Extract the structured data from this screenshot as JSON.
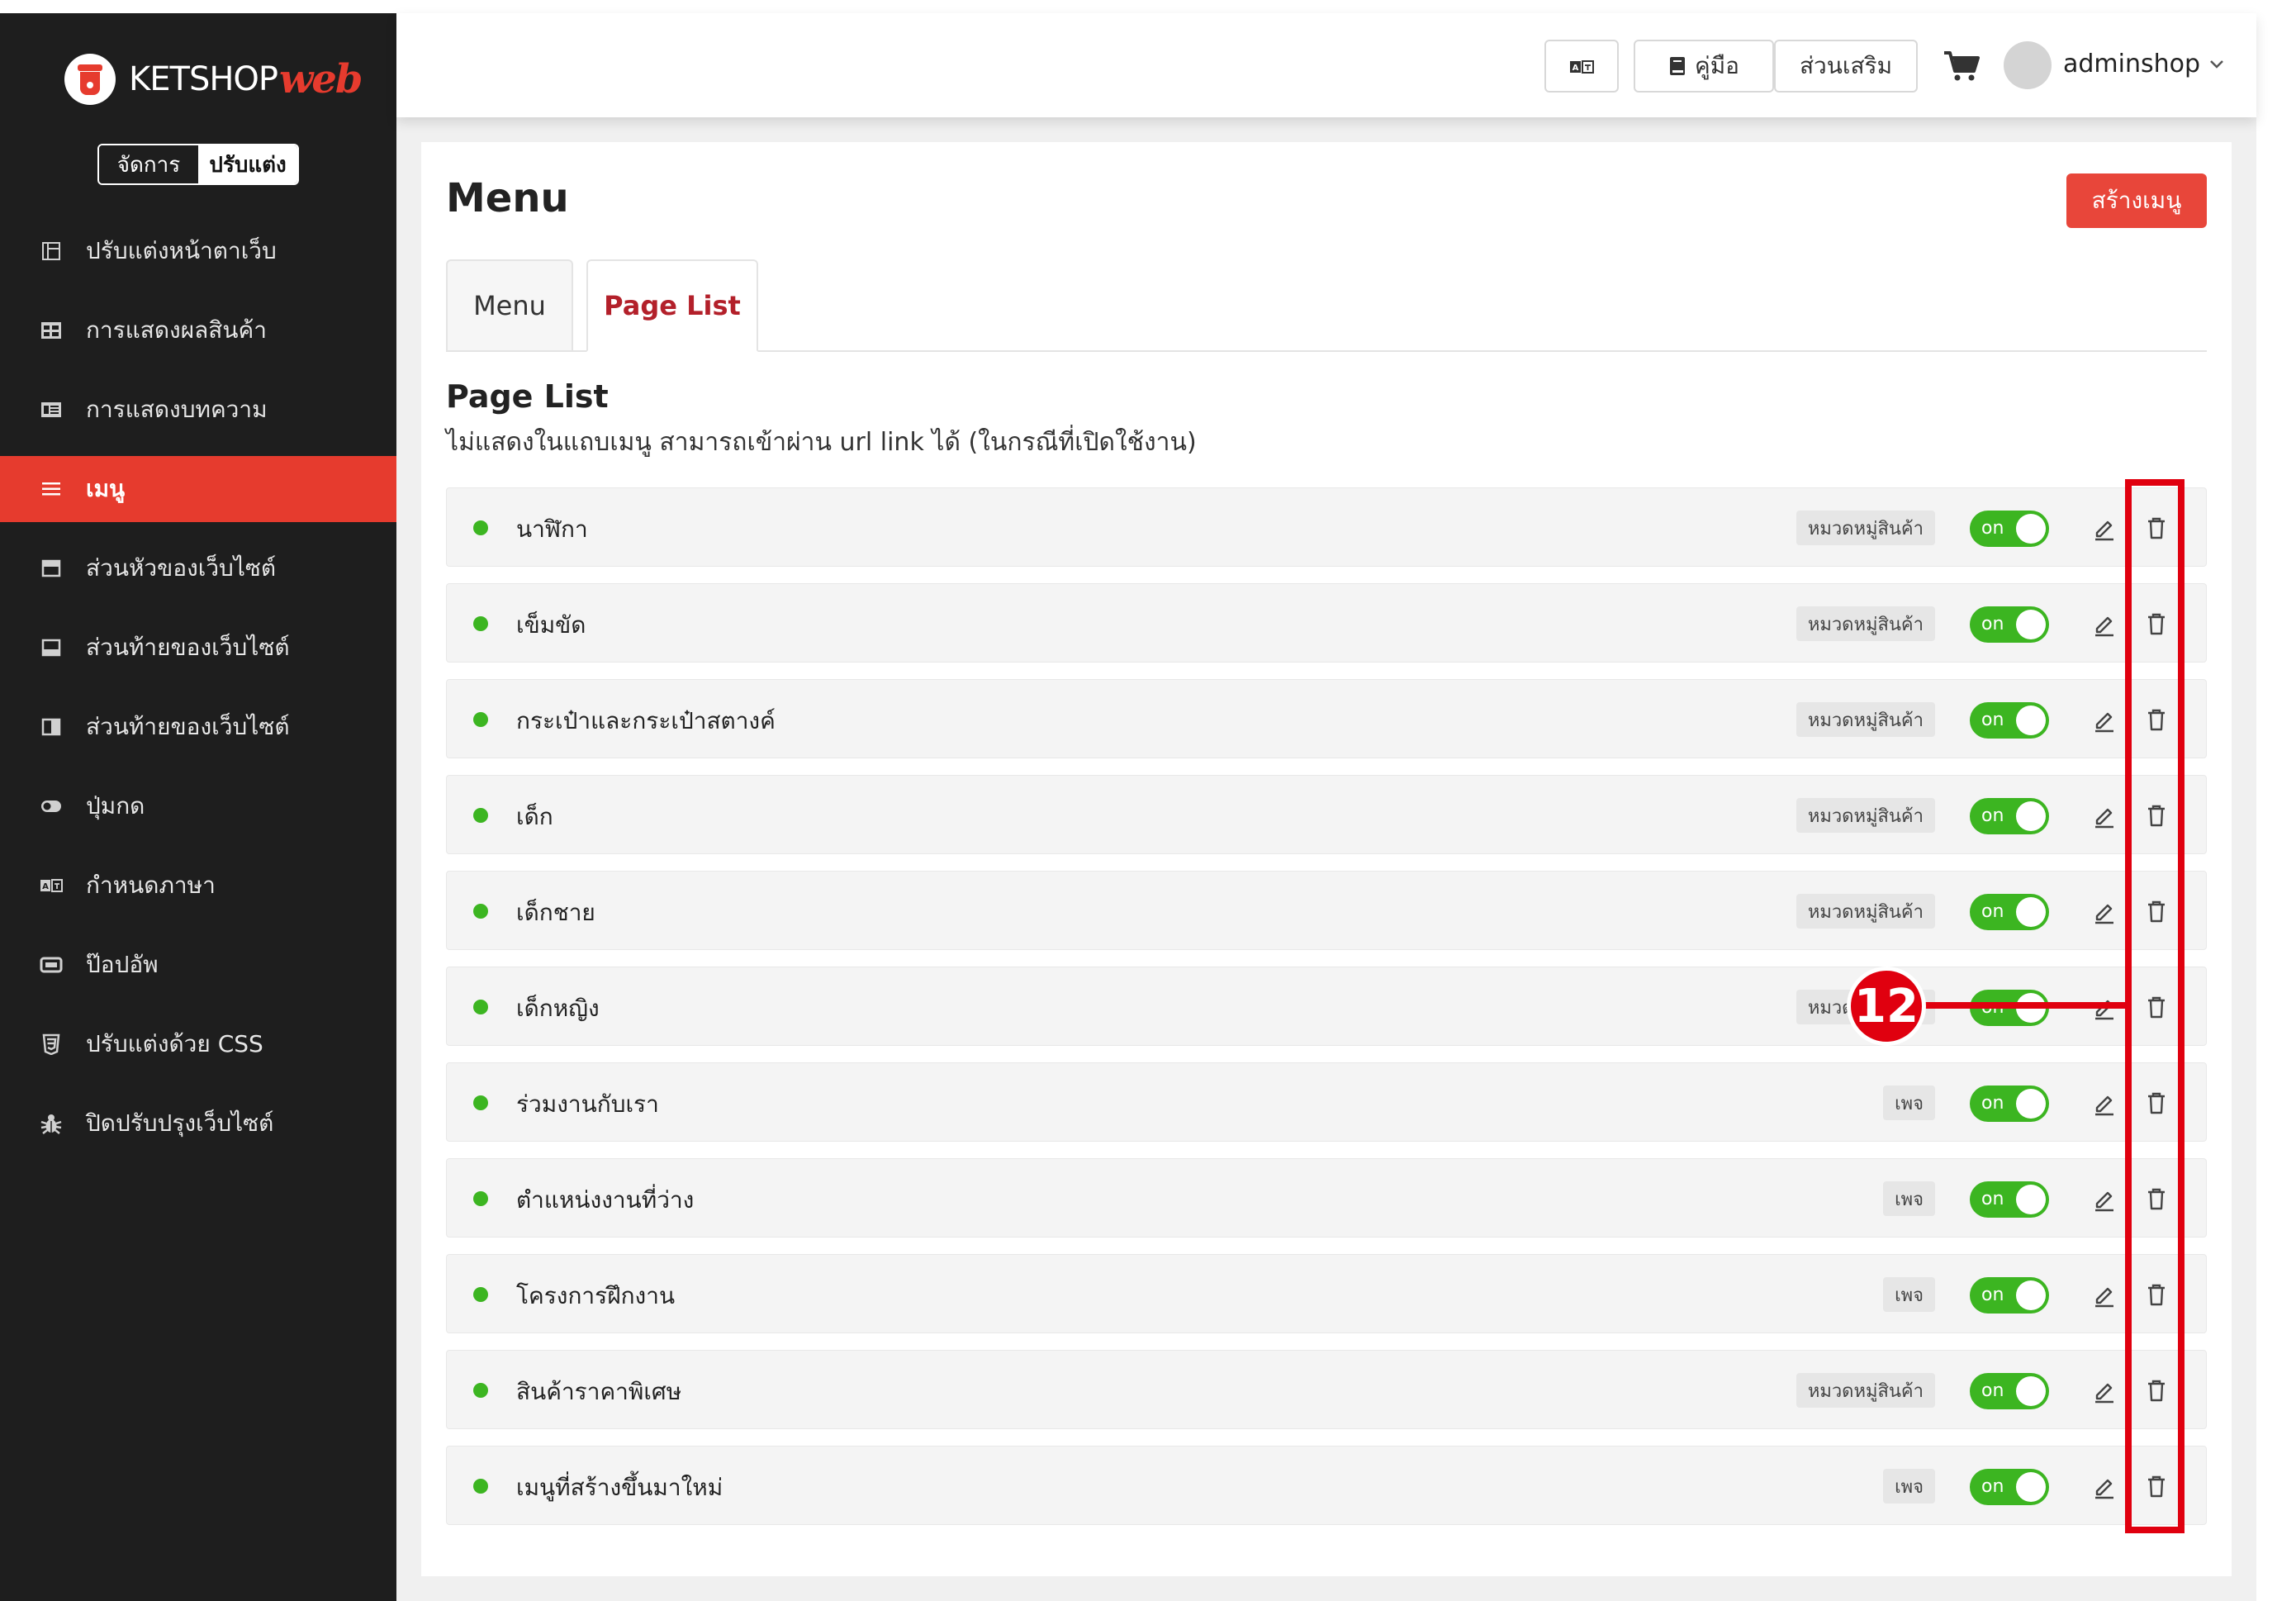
{
  "brand": {
    "name_a": "KETSHOP",
    "name_b": "web"
  },
  "mode_toggle": {
    "manage": "จัดการ",
    "customize": "ปรับแต่ง"
  },
  "sidebar": {
    "items": [
      {
        "label": "ปรับแต่งหน้าตาเว็บ",
        "icon": "layout-icon"
      },
      {
        "label": "การแสดงผลสินค้า",
        "icon": "grid-icon"
      },
      {
        "label": "การแสดงบทความ",
        "icon": "article-icon"
      },
      {
        "label": "เมนู",
        "icon": "menu-icon"
      },
      {
        "label": "ส่วนหัวของเว็บไซต์",
        "icon": "header-icon"
      },
      {
        "label": "ส่วนท้ายของเว็บไซต์",
        "icon": "footer-icon"
      },
      {
        "label": "ส่วนท้ายของเว็บไซต์",
        "icon": "sidebar-panel-icon"
      },
      {
        "label": "ปุ่มกด",
        "icon": "toggle-icon"
      },
      {
        "label": "กำหนดภาษา",
        "icon": "language-icon"
      },
      {
        "label": "ป๊อปอัพ",
        "icon": "popup-icon"
      },
      {
        "label": "ปรับแต่งด้วย CSS",
        "icon": "css3-icon"
      },
      {
        "label": "ปิดปรับปรุงเว็บไซต์",
        "icon": "bug-icon"
      }
    ],
    "active_index": 3
  },
  "topbar": {
    "manual_label": "คู่มือ",
    "addons_label": "ส่วนเสริม",
    "username": "adminshop"
  },
  "main": {
    "title": "Menu",
    "create_button": "สร้างเมนู",
    "tabs": [
      {
        "label": "Menu",
        "active": false
      },
      {
        "label": "Page List",
        "active": true
      }
    ],
    "section_title": "Page List",
    "section_desc": "ไม่แสดงในแถบเมนู สามารถเข้าผ่าน url link ได้ (ในกรณีที่เปิดใช้งาน)",
    "toggle_text": "on",
    "rows": [
      {
        "label": "นาฬิกา",
        "type": "หมวดหมู่สินค้า",
        "enabled": true
      },
      {
        "label": "เข็มขัด",
        "type": "หมวดหมู่สินค้า",
        "enabled": true
      },
      {
        "label": "กระเป๋าและกระเป๋าสตางค์",
        "type": "หมวดหมู่สินค้า",
        "enabled": true
      },
      {
        "label": "เด็ก",
        "type": "หมวดหมู่สินค้า",
        "enabled": true
      },
      {
        "label": "เด็กชาย",
        "type": "หมวดหมู่สินค้า",
        "enabled": true
      },
      {
        "label": "เด็กหญิง",
        "type": "หมวดหมู่สินค้า",
        "enabled": true
      },
      {
        "label": "ร่วมงานกับเรา",
        "type": "เพจ",
        "enabled": true
      },
      {
        "label": "ตำแหน่งงานที่ว่าง",
        "type": "เพจ",
        "enabled": true
      },
      {
        "label": "โครงการฝึกงาน",
        "type": "เพจ",
        "enabled": true
      },
      {
        "label": "สินค้าราคาพิเศษ",
        "type": "หมวดหมู่สินค้า",
        "enabled": true
      },
      {
        "label": "เมนูที่สร้างขึ้นมาใหม่",
        "type": "เพจ",
        "enabled": true
      }
    ]
  },
  "annotation": {
    "badge": "12"
  },
  "colors": {
    "accent_red": "#e63b2e",
    "toggle_green": "#3cb521",
    "annotation_red": "#e0000f",
    "active_tab_text": "#b3202a"
  }
}
